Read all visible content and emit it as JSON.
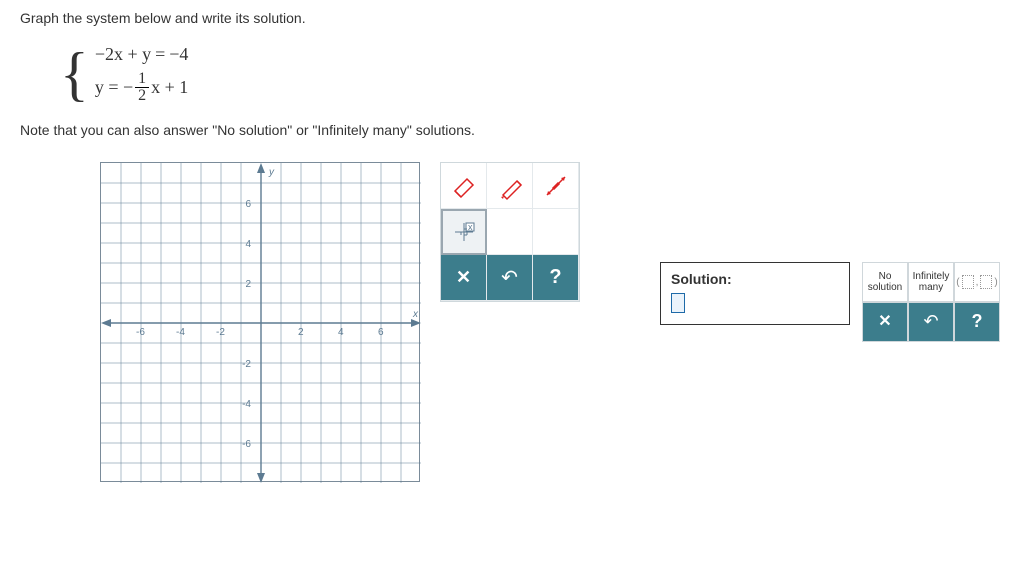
{
  "question": "Graph the system below and write its solution.",
  "equations": {
    "eq1_lhs": "−2x + y",
    "eq1_rhs": "−4",
    "eq2_prefix": "y = −",
    "eq2_frac_num": "1",
    "eq2_frac_den": "2",
    "eq2_suffix": "x + 1"
  },
  "note": "Note that you can also answer \"No solution\" or \"Infinitely many\" solutions.",
  "axes": {
    "x_label": "x",
    "y_label": "y",
    "ticks_neg": [
      "-6",
      "-4",
      "-2"
    ],
    "ticks_pos": [
      "2",
      "4",
      "6"
    ]
  },
  "toolbox": {
    "eraser": "eraser-icon",
    "pencil": "pencil-icon",
    "line": "line-icon",
    "zoom": "zoom-icon",
    "clear": "✕",
    "undo": "↶",
    "help": "?"
  },
  "solution_panel": {
    "label": "Solution:",
    "no_solution": "No solution",
    "inf_many_1": "Infinitely",
    "inf_many_2": "many",
    "clear": "✕",
    "undo": "↶",
    "help": "?"
  }
}
